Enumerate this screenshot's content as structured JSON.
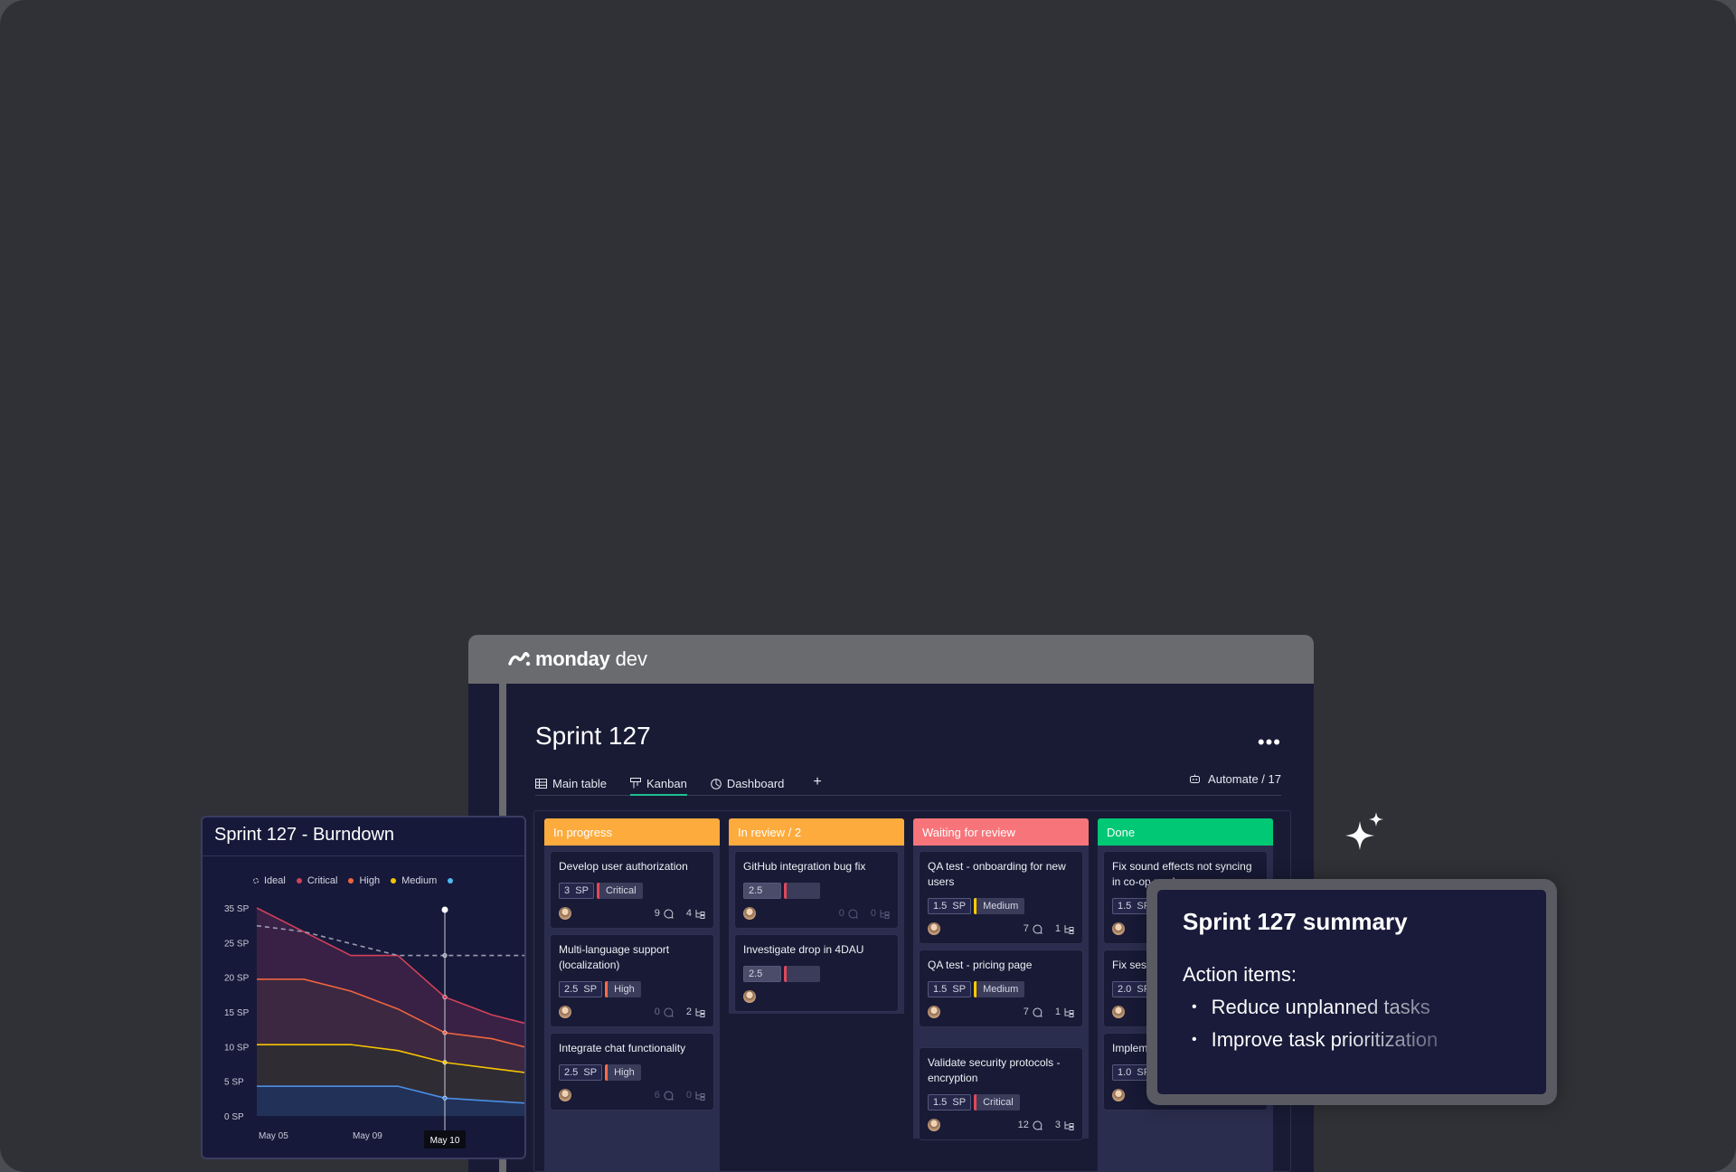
{
  "app": {
    "brand": "monday",
    "product": "dev"
  },
  "board": {
    "title": "Sprint 127",
    "more_label": "•••",
    "tabs": [
      {
        "label": "Main table",
        "icon": "table-icon"
      },
      {
        "label": "Kanban",
        "icon": "kanban-icon",
        "active": true
      },
      {
        "label": "Dashboard",
        "icon": "dashboard-icon"
      }
    ],
    "add_tab_label": "+",
    "automate_label": "Automate / 17"
  },
  "kanban": {
    "columns": [
      {
        "title": "In progress",
        "color": "#fdab3d",
        "cards": [
          {
            "title": "Develop user authorization",
            "sp": "3",
            "sp_unit": "SP",
            "priority": "Critical",
            "priority_color": "#e0485a",
            "comments": "9",
            "subitems": "4"
          },
          {
            "title": "Multi-language support (localization)",
            "sp": "2.5",
            "sp_unit": "SP",
            "priority": "High",
            "priority_color": "#ff6b4a",
            "comments": "0",
            "subitems": "2"
          },
          {
            "title": "Integrate chat functionality",
            "sp": "2.5",
            "sp_unit": "SP",
            "priority": "High",
            "priority_color": "#ff6b4a",
            "comments": "6",
            "subitems": "0"
          }
        ]
      },
      {
        "title": "In review / 2",
        "color": "#fdab3d",
        "cards": [
          {
            "title": "GitHub integration bug fix",
            "sp": "2.5",
            "comments": "0",
            "subitems": "0"
          },
          {
            "title": "Investigate drop in 4DAU",
            "sp": "2.5"
          }
        ]
      },
      {
        "title": "Waiting for review",
        "color": "#f7757a",
        "cards": [
          {
            "title": "QA test - onboarding for new users",
            "sp": "1.5",
            "sp_unit": "SP",
            "priority": "Medium",
            "priority_color": "#ffcb00",
            "comments": "7",
            "subitems": "1"
          },
          {
            "title": "QA test - pricing page",
            "sp": "1.5",
            "sp_unit": "SP",
            "priority": "Medium",
            "priority_color": "#ffcb00",
            "comments": "7",
            "subitems": "1"
          },
          {
            "title": "Validate security protocols - encryption",
            "sp": "1.5",
            "sp_unit": "SP",
            "priority": "Critical",
            "priority_color": "#e0485a",
            "comments": "12",
            "subitems": "3"
          }
        ]
      },
      {
        "title": "Done",
        "color": "#00c875",
        "cards": [
          {
            "title": "Fix sound effects not syncing in co-op mode",
            "sp": "1.5",
            "sp_unit": "SP"
          },
          {
            "title": "Fix sess",
            "sp": "2.0",
            "sp_unit": "SP"
          },
          {
            "title": "Impleme interfac",
            "sp": "1.0",
            "sp_unit": "SP"
          }
        ]
      }
    ]
  },
  "burndown": {
    "title": "Sprint 127 - Burndown",
    "tooltip": "May 10"
  },
  "chart_data": {
    "type": "area",
    "title": "Sprint 127 - Burndown",
    "legend": [
      {
        "name": "Ideal",
        "color": "#c9cad6"
      },
      {
        "name": "Critical",
        "color": "#d2405a"
      },
      {
        "name": "High",
        "color": "#f0643f"
      },
      {
        "name": "Medium",
        "color": "#f5c400"
      }
    ],
    "y_ticks": [
      "35 SP",
      "25 SP",
      "20 SP",
      "15 SP",
      "10 SP",
      "5 SP",
      "0 SP"
    ],
    "x_ticks": [
      "May 05",
      "May 09"
    ],
    "x": [
      0,
      1,
      2,
      3,
      4,
      5,
      6
    ],
    "series": [
      {
        "name": "Critical",
        "values": [
          35,
          31,
          27,
          27,
          20,
          17,
          15
        ],
        "color": "#d2405a"
      },
      {
        "name": "High",
        "values": [
          23,
          23,
          21,
          18,
          14,
          13,
          11
        ],
        "color": "#f0643f"
      },
      {
        "name": "Medium",
        "values": [
          12,
          12,
          12,
          11,
          9,
          8,
          7
        ],
        "color": "#f5c400"
      },
      {
        "name": "",
        "values": [
          5,
          5,
          5,
          5,
          3,
          2.5,
          2
        ],
        "color": "#4a8fe7"
      },
      {
        "name": "Ideal",
        "values": [
          32,
          31,
          29,
          27,
          27,
          27,
          27
        ],
        "color": "#9a9bb0",
        "dashed": true
      }
    ],
    "cursor_index": 4
  },
  "summary": {
    "title": "Sprint 127 summary",
    "subtitle": "Action items:",
    "items": [
      "Reduce unplanned tasks",
      "Improve task prioritization"
    ]
  }
}
